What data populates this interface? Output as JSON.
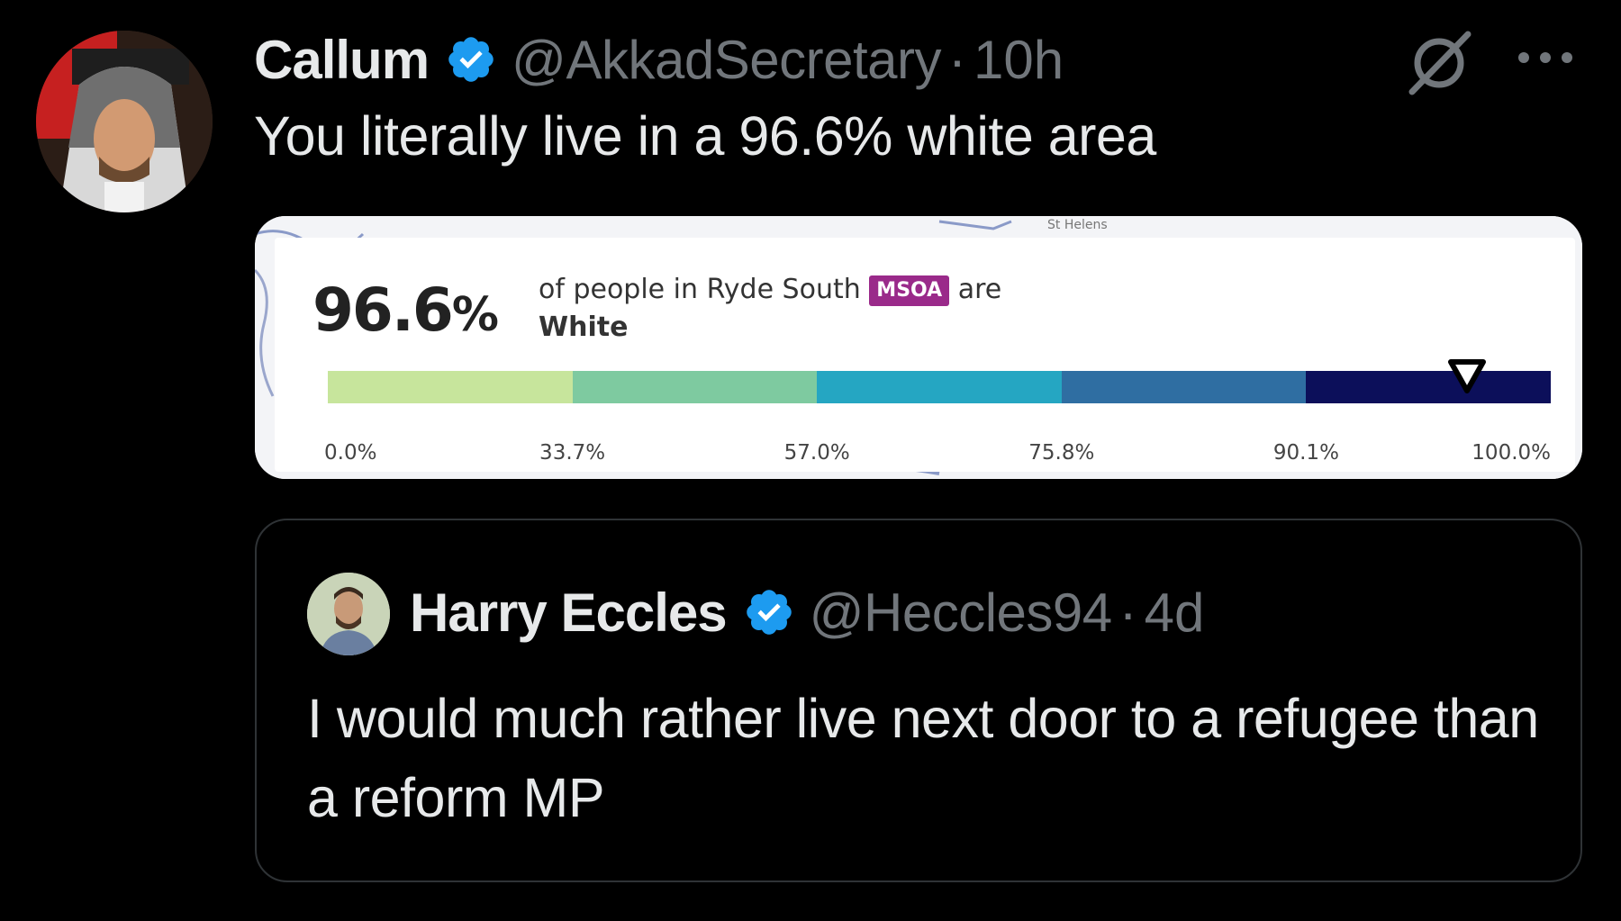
{
  "tweet": {
    "author_name": "Callum",
    "author_handle": "@AkkadSecretary",
    "separator": "·",
    "time": "10h",
    "text": "You literally live in a 96.6% white area",
    "verified": true
  },
  "media": {
    "map_label": "St Helens",
    "percentage_number": "96.6",
    "percentage_sign": "%",
    "description_prefix": "of people in Ryde South",
    "badge": "MSOA",
    "description_suffix": "are",
    "description_group": "White",
    "scale_value_percent": 96.6,
    "scale_colors": [
      "#c7e59c",
      "#7ecaa0",
      "#25a6c2",
      "#2f6ea2",
      "#0c0f5a"
    ],
    "scale_ticks": [
      "0.0%",
      "33.7%",
      "57.0%",
      "75.8%",
      "90.1%",
      "100.0%"
    ]
  },
  "quoted_tweet": {
    "author_name": "Harry Eccles",
    "author_handle": "@Heccles94",
    "separator": "·",
    "time": "4d",
    "text": "I would much rather live next door to a refugee than a reform MP",
    "verified": true
  },
  "colors": {
    "background": "#000000",
    "text_primary": "#e7e9ea",
    "text_secondary": "#71767b",
    "verified_blue": "#1d9bf0",
    "border": "#2f3336"
  },
  "icons": {
    "verified": "verified-badge-icon",
    "grok": "grok-icon",
    "more": "more-options-icon"
  }
}
